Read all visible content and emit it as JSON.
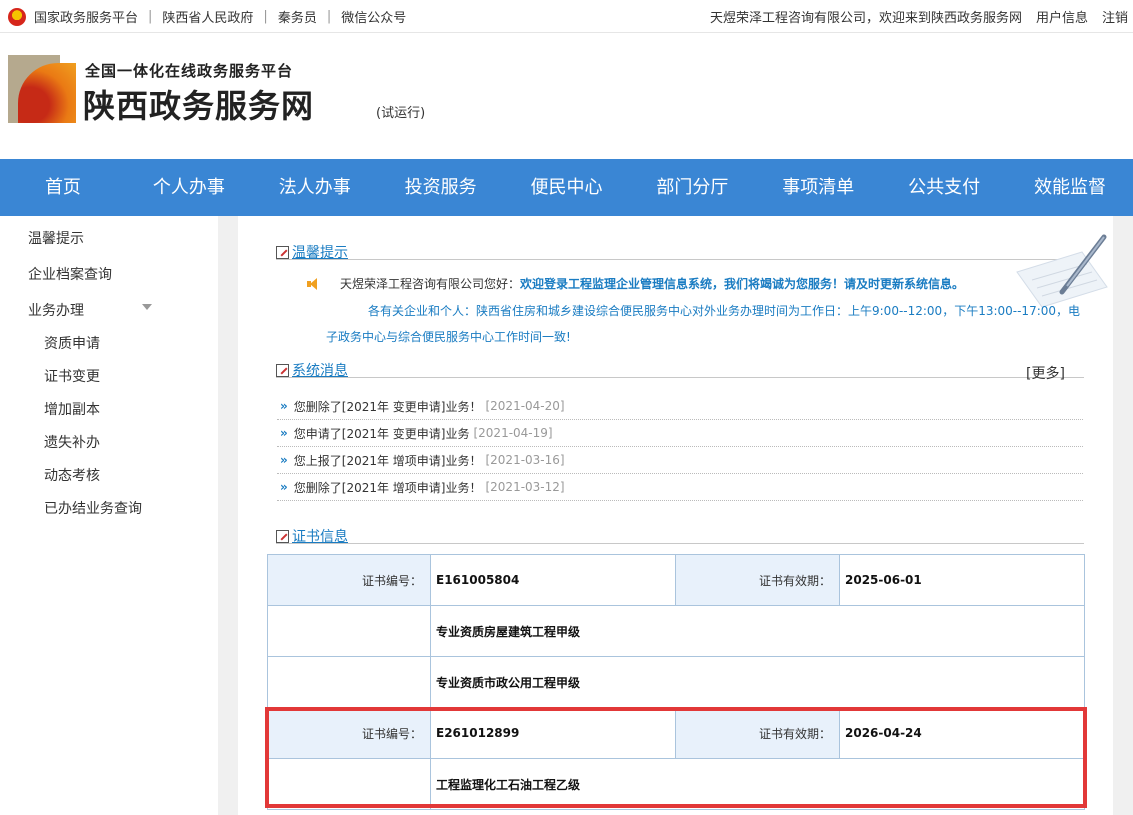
{
  "topbar": {
    "links": [
      "国家政务服务平台",
      "陕西省人民政府",
      "秦务员",
      "微信公众号"
    ],
    "welcome": "天煜荣泽工程咨询有限公司，欢迎来到陕西政务服务网",
    "user_info": "用户信息",
    "logout": "注销"
  },
  "header": {
    "subtitle": "全国一体化在线政务服务平台",
    "title": "陕西政务服务网",
    "trial": "(试运行)"
  },
  "nav": [
    "首页",
    "个人办事",
    "法人办事",
    "投资服务",
    "便民中心",
    "部门分厅",
    "事项清单",
    "公共支付",
    "效能监督"
  ],
  "sidebar": {
    "top_items": [
      "温馨提示",
      "企业档案查询",
      "业务办理"
    ],
    "sub_items": [
      "资质申请",
      "证书变更",
      "增加副本",
      "遗失补办",
      "动态考核",
      "已办结业务查询"
    ]
  },
  "notice": {
    "title": "温馨提示",
    "greeting": "天煜荣泽工程咨询有限公司您好：",
    "highlight": "欢迎登录工程监理企业管理信息系统，我们将竭诚为您服务！请及时更新系统信息。",
    "hours": "各有关企业和个人：陕西省住房和城乡建设综合便民服务中心对外业务办理时间为工作日：上午9:00--12:00，下午13:00--17:00，电子政务中心与综合便民服务中心工作时间一致!"
  },
  "messages": {
    "title": "系统消息",
    "more": "[更多]",
    "items": [
      {
        "text": "您删除了[2021年 变更申请]业务！",
        "date": "[2021-04-20]"
      },
      {
        "text": "您申请了[2021年 变更申请]业务",
        "date": "[2021-04-19]"
      },
      {
        "text": "您上报了[2021年 增项申请]业务！",
        "date": "[2021-03-16]"
      },
      {
        "text": "您删除了[2021年 增项申请]业务！",
        "date": "[2021-03-12]"
      }
    ]
  },
  "certs": {
    "title": "证书信息",
    "no_label": "证书编号：",
    "valid_label": "证书有效期：",
    "list": [
      {
        "no": "E161005804",
        "valid": "2025-06-01",
        "quals": [
          "专业资质房屋建筑工程甲级",
          "专业资质市政公用工程甲级"
        ]
      },
      {
        "no": "E261012899",
        "valid": "2026-04-24",
        "quals": [
          "工程监理化工石油工程乙级"
        ]
      }
    ]
  },
  "colors": {
    "nav_bg": "#3a86d4",
    "link": "#1a7cc2",
    "highlight_box": "#e23838"
  }
}
